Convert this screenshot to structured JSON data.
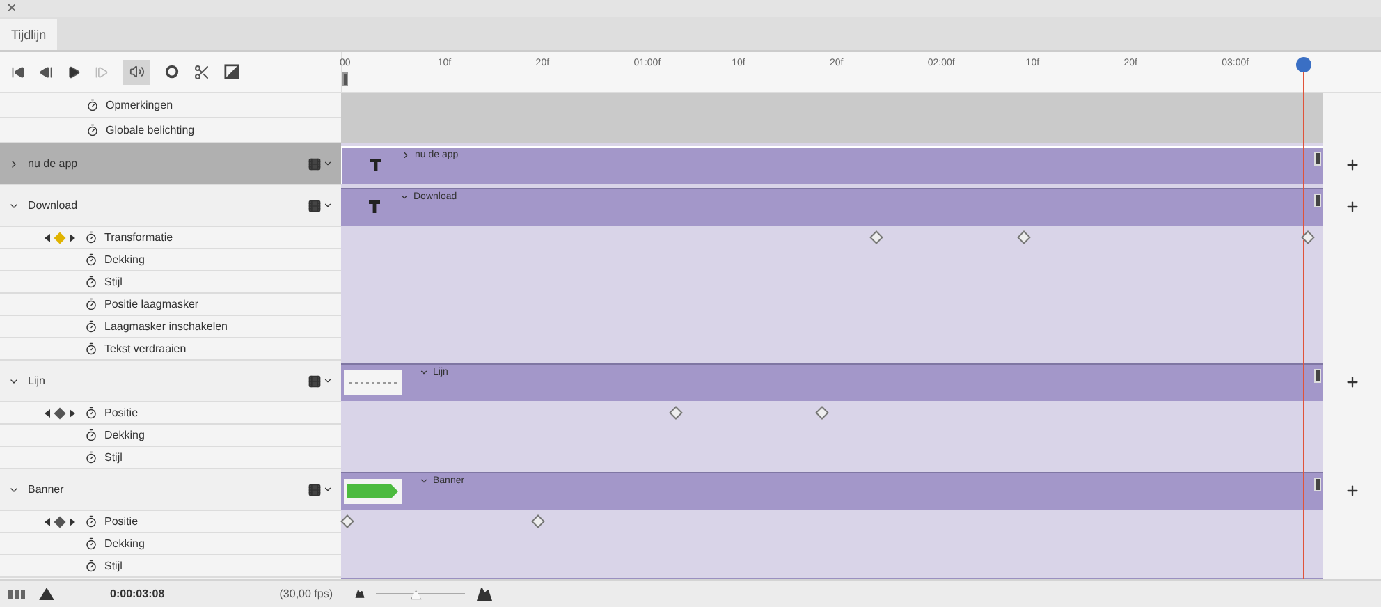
{
  "window": {
    "tab": "Tijdlijn"
  },
  "ruler": {
    "labels": [
      "00",
      "10f",
      "20f",
      "01:00f",
      "10f",
      "20f",
      "02:00f",
      "10f",
      "20f",
      "03:00f"
    ]
  },
  "global_tracks": [
    {
      "label": "Opmerkingen"
    },
    {
      "label": "Globale belichting"
    }
  ],
  "layers": [
    {
      "name": "nu de app",
      "clip_label": "nu de app",
      "kind": "text",
      "selected": true,
      "expanded": false
    },
    {
      "name": "Download",
      "clip_label": "Download",
      "kind": "text",
      "selected": false,
      "expanded": true,
      "properties": [
        {
          "label": "Transformatie",
          "on_keyframe": true,
          "keyframes": [
            {
              "level": 0.545
            },
            {
              "level": 0.695
            },
            {
              "level": 0.985
            }
          ]
        },
        {
          "label": "Dekking"
        },
        {
          "label": "Stijl"
        },
        {
          "label": "Positie laagmasker"
        },
        {
          "label": "Laagmasker inschakelen"
        },
        {
          "label": "Tekst verdraaien"
        }
      ]
    },
    {
      "name": "Lijn",
      "clip_label": "Lijn",
      "kind": "shape",
      "selected": false,
      "expanded": true,
      "properties": [
        {
          "label": "Positie",
          "on_keyframe": false,
          "keyframes": [
            {
              "level": 0.34
            },
            {
              "level": 0.49
            }
          ]
        },
        {
          "label": "Dekking"
        },
        {
          "label": "Stijl"
        }
      ]
    },
    {
      "name": "Banner",
      "clip_label": "Banner",
      "kind": "image",
      "selected": false,
      "expanded": true,
      "properties": [
        {
          "label": "Positie",
          "on_keyframe": false,
          "keyframes": [
            {
              "level": 0.0
            },
            {
              "level": 0.2
            }
          ]
        },
        {
          "label": "Dekking"
        },
        {
          "label": "Stijl"
        }
      ]
    }
  ],
  "status_bar": {
    "timecode": "0:00:03:08",
    "fps": "(30,00 fps)",
    "zoom": {
      "level": 0.45
    }
  }
}
